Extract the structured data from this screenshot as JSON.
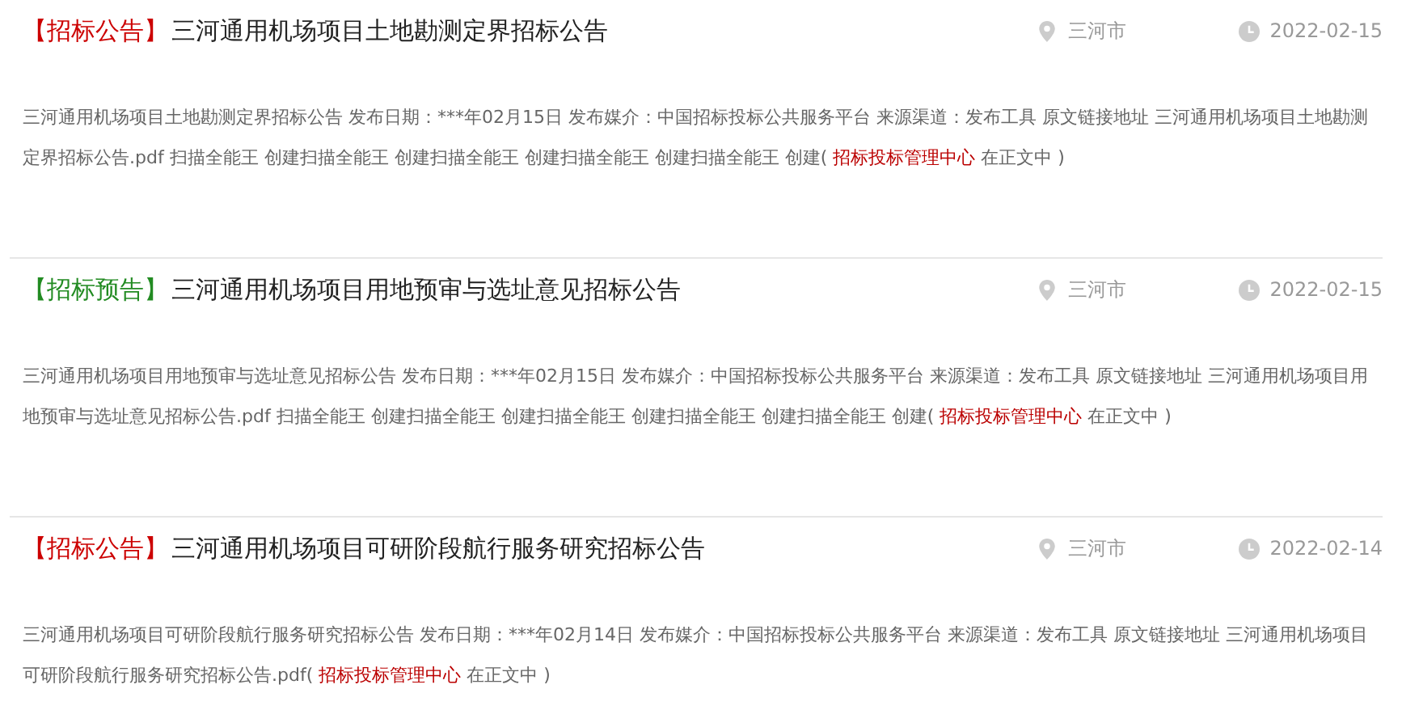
{
  "items": [
    {
      "tag": "【招标公告】",
      "color": "#cc0000",
      "title": "三河通用机场项目土地勘测定界招标公告",
      "location": "三河市",
      "date": "2022-02-15",
      "summary_before": "三河通用机场项目土地勘测定界招标公告 发布日期：***年02月15日 发布媒介：中国招标投标公共服务平台 来源渠道：发布工具 原文链接地址 三河通用机场项目土地勘测定界招标公告.pdf 扫描全能王 创建扫描全能王 创建扫描全能王 创建扫描全能王 创建扫描全能王 创建(",
      "summary_link": "招标投标管理中心",
      "summary_after": "在正文中 )"
    },
    {
      "tag": "【招标预告】",
      "color": "#228b22",
      "title": "三河通用机场项目用地预审与选址意见招标公告",
      "location": "三河市",
      "date": "2022-02-15",
      "summary_before": "三河通用机场项目用地预审与选址意见招标公告 发布日期：***年02月15日 发布媒介：中国招标投标公共服务平台 来源渠道：发布工具 原文链接地址 三河通用机场项目用地预审与选址意见招标公告.pdf 扫描全能王 创建扫描全能王 创建扫描全能王 创建扫描全能王 创建扫描全能王 创建(",
      "summary_link": "招标投标管理中心",
      "summary_after": "在正文中 )"
    },
    {
      "tag": "【招标公告】",
      "color": "#cc0000",
      "title": "三河通用机场项目可研阶段航行服务研究招标公告",
      "location": "三河市",
      "date": "2022-02-14",
      "summary_before": "三河通用机场项目可研阶段航行服务研究招标公告 发布日期：***年02月14日 发布媒介：中国招标投标公共服务平台 来源渠道：发布工具 原文链接地址 三河通用机场项目可研阶段航行服务研究招标公告.pdf(",
      "summary_link": "招标投标管理中心",
      "summary_after": "在正文中 )"
    }
  ]
}
